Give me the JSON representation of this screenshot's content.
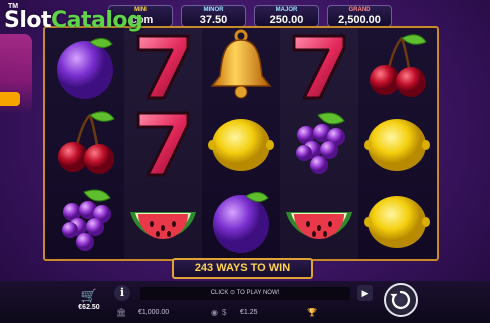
{
  "logo": {
    "tm": "TM",
    "part1": "Slot",
    "part2": "Catalog"
  },
  "jackpots": [
    {
      "label": "MINI",
      "value": "",
      "overlay": ".com"
    },
    {
      "label": "MINOR",
      "value": "37.50"
    },
    {
      "label": "MAJOR",
      "value": "250.00"
    },
    {
      "label": "GRAND",
      "value": "2,500.00"
    }
  ],
  "reels": [
    [
      "plum",
      "cherry",
      "grapes"
    ],
    [
      "seven",
      "seven",
      "watermelon"
    ],
    [
      "bell",
      "lemon",
      "plum"
    ],
    [
      "seven",
      "grapes",
      "watermelon"
    ],
    [
      "cherry",
      "lemon",
      "lemon"
    ]
  ],
  "ways_text": "243 WAYS TO WIN",
  "controls": {
    "bet_amount": "€62.50",
    "info_label": "i",
    "message": "CLICK  ⊙  TO PLAY NOW!",
    "balance": "€1,000.00",
    "win": "€1.25"
  },
  "colors": {
    "frame": "#c98a2a",
    "ways_text": "#ffd54a",
    "background": "#3a1460"
  }
}
